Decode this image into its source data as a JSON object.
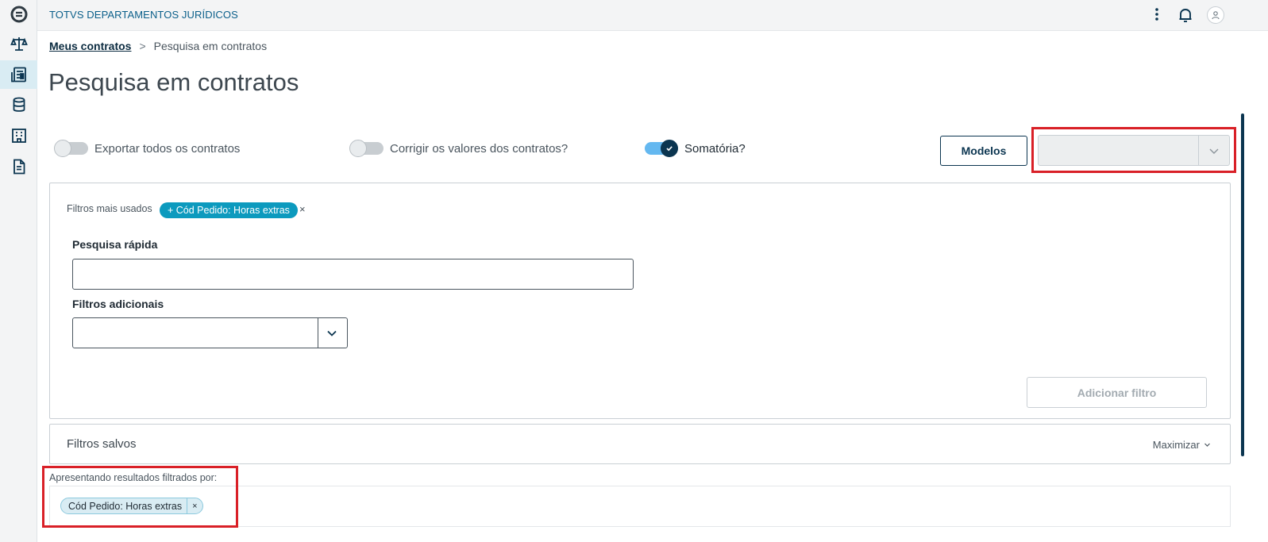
{
  "app": {
    "title": "TOTVS DEPARTAMENTOS JURÍDICOS"
  },
  "rail": {
    "items": [
      {
        "icon": "totvs-logo-icon",
        "active": false
      },
      {
        "icon": "scales-icon",
        "active": false
      },
      {
        "icon": "contracts-document-icon",
        "active": true
      },
      {
        "icon": "database-icon",
        "active": false
      },
      {
        "icon": "building-icon",
        "active": false
      },
      {
        "icon": "file-text-icon",
        "active": false
      }
    ]
  },
  "topbar": {
    "more_icon": "more-vertical-icon",
    "bell_icon": "bell-icon",
    "avatar_icon": "user-avatar-icon"
  },
  "breadcrumb": {
    "link": "Meus contratos",
    "separator": ">",
    "current": "Pesquisa em contratos"
  },
  "page": {
    "title": "Pesquisa em contratos"
  },
  "options": {
    "export_all": {
      "label": "Exportar todos os contratos",
      "checked": false
    },
    "correct_values": {
      "label": "Corrigir os valores dos contratos?",
      "checked": false
    },
    "sum": {
      "label": "Somatória?",
      "checked": true
    }
  },
  "models": {
    "button_label": "Modelos",
    "select_value": ""
  },
  "filters": {
    "most_used_label": "Filtros mais usados",
    "most_used_chip": "+ Cód Pedido: Horas extras",
    "most_used_remove": "×",
    "quick_search_label": "Pesquisa rápida",
    "quick_search_value": "",
    "additional_label": "Filtros adicionais",
    "additional_value": "",
    "add_button": "Adicionar filtro"
  },
  "saved_filters": {
    "title": "Filtros salvos",
    "maximize": "Maximizar"
  },
  "results": {
    "label": "Apresentando resultados filtrados por:",
    "chips": [
      {
        "text": "Cód Pedido: Horas extras",
        "remove": "×"
      }
    ]
  },
  "colors": {
    "brand": "#0b5f8a",
    "primary_dark": "#0b3550",
    "chip": "#0c9abe",
    "highlight": "#d92027"
  }
}
